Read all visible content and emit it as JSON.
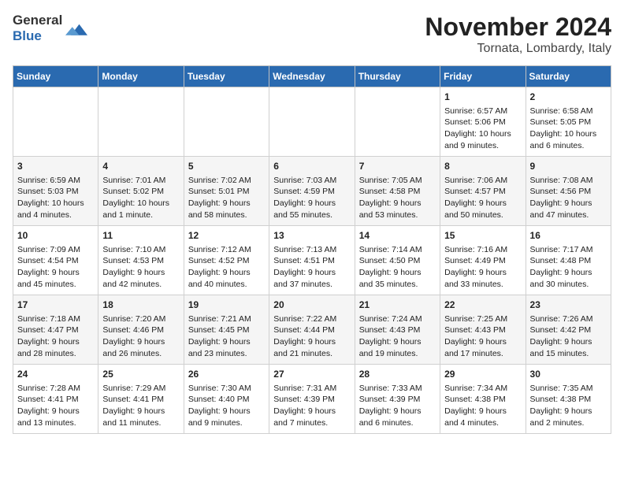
{
  "header": {
    "logo_line1": "General",
    "logo_line2": "Blue",
    "month_title": "November 2024",
    "location": "Tornata, Lombardy, Italy"
  },
  "weekdays": [
    "Sunday",
    "Monday",
    "Tuesday",
    "Wednesday",
    "Thursday",
    "Friday",
    "Saturday"
  ],
  "weeks": [
    [
      {
        "day": "",
        "info": ""
      },
      {
        "day": "",
        "info": ""
      },
      {
        "day": "",
        "info": ""
      },
      {
        "day": "",
        "info": ""
      },
      {
        "day": "",
        "info": ""
      },
      {
        "day": "1",
        "info": "Sunrise: 6:57 AM\nSunset: 5:06 PM\nDaylight: 10 hours and 9 minutes."
      },
      {
        "day": "2",
        "info": "Sunrise: 6:58 AM\nSunset: 5:05 PM\nDaylight: 10 hours and 6 minutes."
      }
    ],
    [
      {
        "day": "3",
        "info": "Sunrise: 6:59 AM\nSunset: 5:03 PM\nDaylight: 10 hours and 4 minutes."
      },
      {
        "day": "4",
        "info": "Sunrise: 7:01 AM\nSunset: 5:02 PM\nDaylight: 10 hours and 1 minute."
      },
      {
        "day": "5",
        "info": "Sunrise: 7:02 AM\nSunset: 5:01 PM\nDaylight: 9 hours and 58 minutes."
      },
      {
        "day": "6",
        "info": "Sunrise: 7:03 AM\nSunset: 4:59 PM\nDaylight: 9 hours and 55 minutes."
      },
      {
        "day": "7",
        "info": "Sunrise: 7:05 AM\nSunset: 4:58 PM\nDaylight: 9 hours and 53 minutes."
      },
      {
        "day": "8",
        "info": "Sunrise: 7:06 AM\nSunset: 4:57 PM\nDaylight: 9 hours and 50 minutes."
      },
      {
        "day": "9",
        "info": "Sunrise: 7:08 AM\nSunset: 4:56 PM\nDaylight: 9 hours and 47 minutes."
      }
    ],
    [
      {
        "day": "10",
        "info": "Sunrise: 7:09 AM\nSunset: 4:54 PM\nDaylight: 9 hours and 45 minutes."
      },
      {
        "day": "11",
        "info": "Sunrise: 7:10 AM\nSunset: 4:53 PM\nDaylight: 9 hours and 42 minutes."
      },
      {
        "day": "12",
        "info": "Sunrise: 7:12 AM\nSunset: 4:52 PM\nDaylight: 9 hours and 40 minutes."
      },
      {
        "day": "13",
        "info": "Sunrise: 7:13 AM\nSunset: 4:51 PM\nDaylight: 9 hours and 37 minutes."
      },
      {
        "day": "14",
        "info": "Sunrise: 7:14 AM\nSunset: 4:50 PM\nDaylight: 9 hours and 35 minutes."
      },
      {
        "day": "15",
        "info": "Sunrise: 7:16 AM\nSunset: 4:49 PM\nDaylight: 9 hours and 33 minutes."
      },
      {
        "day": "16",
        "info": "Sunrise: 7:17 AM\nSunset: 4:48 PM\nDaylight: 9 hours and 30 minutes."
      }
    ],
    [
      {
        "day": "17",
        "info": "Sunrise: 7:18 AM\nSunset: 4:47 PM\nDaylight: 9 hours and 28 minutes."
      },
      {
        "day": "18",
        "info": "Sunrise: 7:20 AM\nSunset: 4:46 PM\nDaylight: 9 hours and 26 minutes."
      },
      {
        "day": "19",
        "info": "Sunrise: 7:21 AM\nSunset: 4:45 PM\nDaylight: 9 hours and 23 minutes."
      },
      {
        "day": "20",
        "info": "Sunrise: 7:22 AM\nSunset: 4:44 PM\nDaylight: 9 hours and 21 minutes."
      },
      {
        "day": "21",
        "info": "Sunrise: 7:24 AM\nSunset: 4:43 PM\nDaylight: 9 hours and 19 minutes."
      },
      {
        "day": "22",
        "info": "Sunrise: 7:25 AM\nSunset: 4:43 PM\nDaylight: 9 hours and 17 minutes."
      },
      {
        "day": "23",
        "info": "Sunrise: 7:26 AM\nSunset: 4:42 PM\nDaylight: 9 hours and 15 minutes."
      }
    ],
    [
      {
        "day": "24",
        "info": "Sunrise: 7:28 AM\nSunset: 4:41 PM\nDaylight: 9 hours and 13 minutes."
      },
      {
        "day": "25",
        "info": "Sunrise: 7:29 AM\nSunset: 4:41 PM\nDaylight: 9 hours and 11 minutes."
      },
      {
        "day": "26",
        "info": "Sunrise: 7:30 AM\nSunset: 4:40 PM\nDaylight: 9 hours and 9 minutes."
      },
      {
        "day": "27",
        "info": "Sunrise: 7:31 AM\nSunset: 4:39 PM\nDaylight: 9 hours and 7 minutes."
      },
      {
        "day": "28",
        "info": "Sunrise: 7:33 AM\nSunset: 4:39 PM\nDaylight: 9 hours and 6 minutes."
      },
      {
        "day": "29",
        "info": "Sunrise: 7:34 AM\nSunset: 4:38 PM\nDaylight: 9 hours and 4 minutes."
      },
      {
        "day": "30",
        "info": "Sunrise: 7:35 AM\nSunset: 4:38 PM\nDaylight: 9 hours and 2 minutes."
      }
    ]
  ]
}
